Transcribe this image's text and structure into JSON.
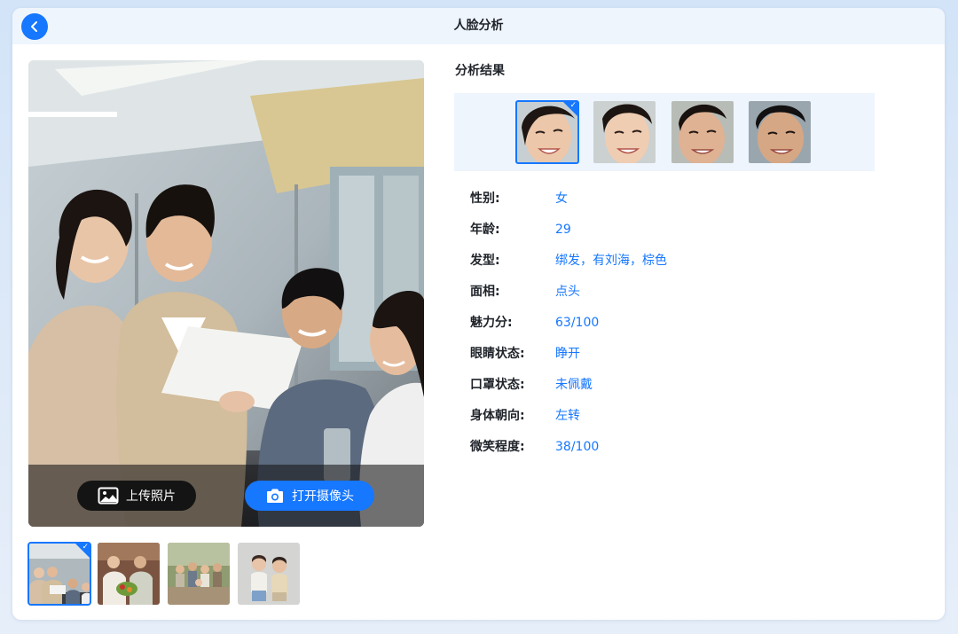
{
  "page_title": "人脸分析",
  "photo_actions": {
    "upload_label": "上传照片",
    "camera_label": "打开摄像头"
  },
  "gallery": [
    {
      "name": "office-team-photo",
      "selected": true
    },
    {
      "name": "family-grocery-photo",
      "selected": false
    },
    {
      "name": "family-outdoor-photo",
      "selected": false
    },
    {
      "name": "two-children-photo",
      "selected": false
    }
  ],
  "analysis": {
    "title": "分析结果",
    "faces": [
      {
        "name": "face-1",
        "selected": true
      },
      {
        "name": "face-2",
        "selected": false
      },
      {
        "name": "face-3",
        "selected": false
      },
      {
        "name": "face-4",
        "selected": false
      }
    ],
    "attributes": [
      {
        "label": "性别:",
        "value": "女"
      },
      {
        "label": "年龄:",
        "value": "29"
      },
      {
        "label": "发型:",
        "value": "绑发，有刘海，棕色"
      },
      {
        "label": "面相:",
        "value": "点头"
      },
      {
        "label": "魅力分:",
        "value": "63/100"
      },
      {
        "label": "眼睛状态:",
        "value": "睁开"
      },
      {
        "label": "口罩状态:",
        "value": "未佩戴"
      },
      {
        "label": "身体朝向:",
        "value": "左转"
      },
      {
        "label": "微笑程度:",
        "value": "38/100"
      }
    ]
  },
  "colors": {
    "accent": "#1677ff",
    "title_bar": "#eef5fd",
    "text": "#1f2329"
  }
}
